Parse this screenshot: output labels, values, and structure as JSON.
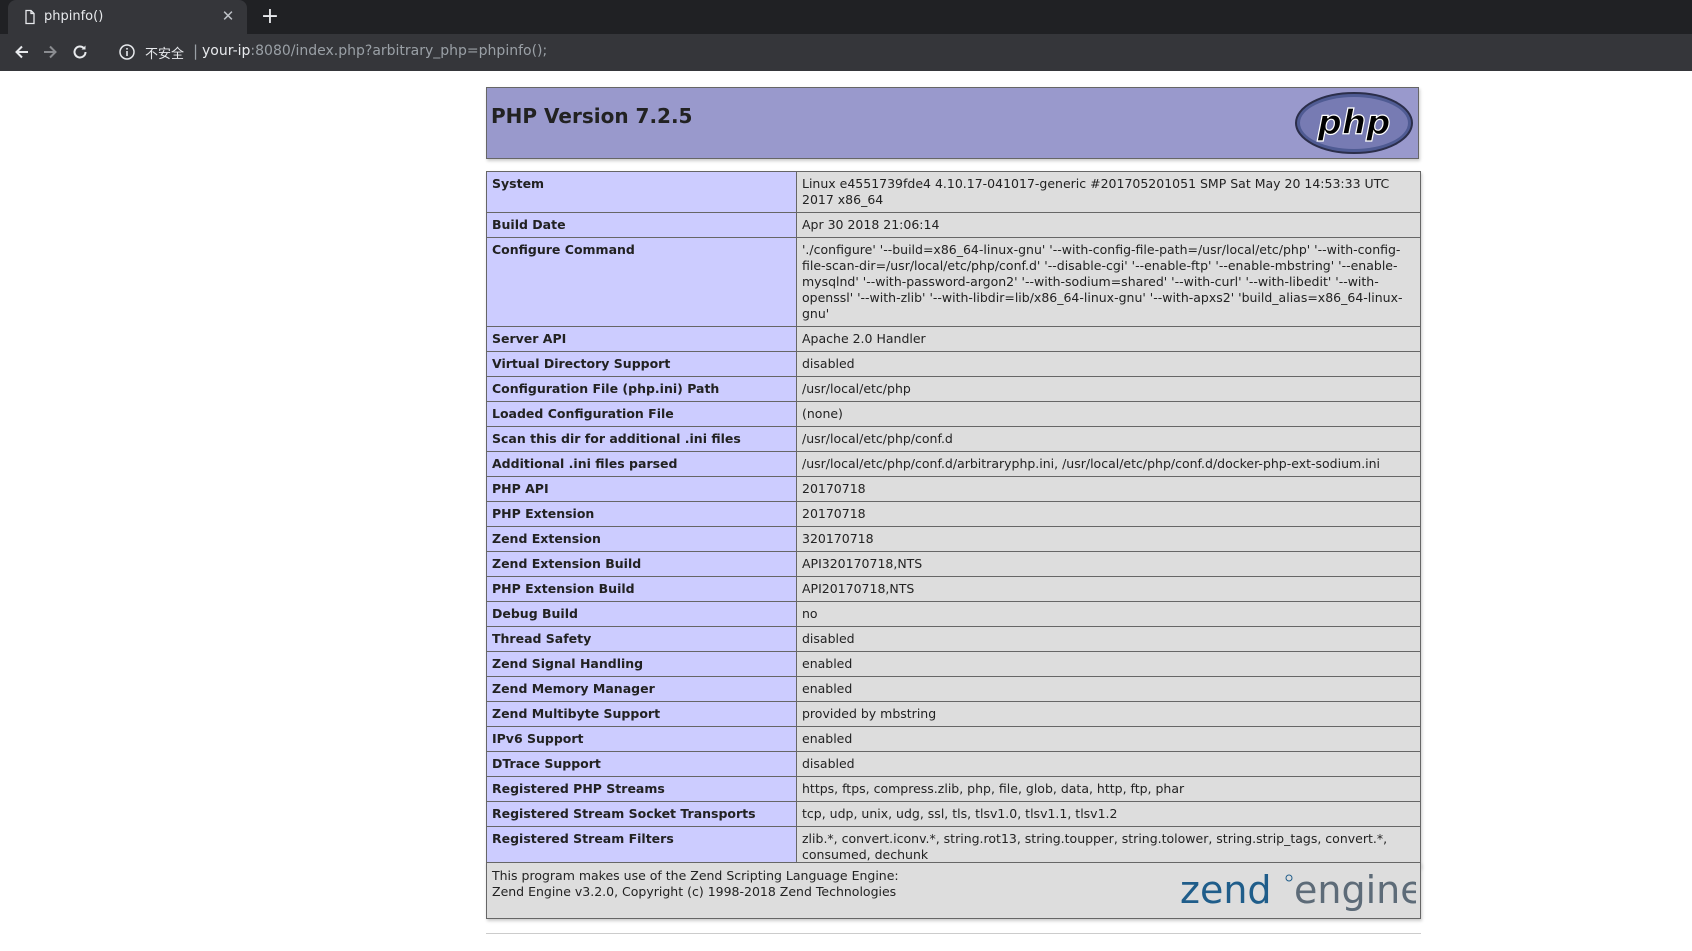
{
  "browser": {
    "tab_title": "phpinfo()",
    "insecure_label": "不安全",
    "url_host": "your-ip",
    "url_rest": ":8080/index.php?arbitrary_php=phpinfo();"
  },
  "header": {
    "title": "PHP Version 7.2.5",
    "logo_text": "php"
  },
  "rows": [
    {
      "k": "System",
      "v": "Linux e4551739fde4 4.10.17-041017-generic #201705201051 SMP Sat May 20 14:53:33 UTC 2017 x86_64"
    },
    {
      "k": "Build Date",
      "v": "Apr 30 2018 21:06:14"
    },
    {
      "k": "Configure Command",
      "v": "'./configure' '--build=x86_64-linux-gnu' '--with-config-file-path=/usr/local/etc/php' '--with-config-file-scan-dir=/usr/local/etc/php/conf.d' '--disable-cgi' '--enable-ftp' '--enable-mbstring' '--enable-mysqlnd' '--with-password-argon2' '--with-sodium=shared' '--with-curl' '--with-libedit' '--with-openssl' '--with-zlib' '--with-libdir=lib/x86_64-linux-gnu' '--with-apxs2' 'build_alias=x86_64-linux-gnu'"
    },
    {
      "k": "Server API",
      "v": "Apache 2.0 Handler"
    },
    {
      "k": "Virtual Directory Support",
      "v": "disabled"
    },
    {
      "k": "Configuration File (php.ini) Path",
      "v": "/usr/local/etc/php"
    },
    {
      "k": "Loaded Configuration File",
      "v": "(none)"
    },
    {
      "k": "Scan this dir for additional .ini files",
      "v": "/usr/local/etc/php/conf.d"
    },
    {
      "k": "Additional .ini files parsed",
      "v": "/usr/local/etc/php/conf.d/arbitraryphp.ini, /usr/local/etc/php/conf.d/docker-php-ext-sodium.ini"
    },
    {
      "k": "PHP API",
      "v": "20170718"
    },
    {
      "k": "PHP Extension",
      "v": "20170718"
    },
    {
      "k": "Zend Extension",
      "v": "320170718"
    },
    {
      "k": "Zend Extension Build",
      "v": "API320170718,NTS"
    },
    {
      "k": "PHP Extension Build",
      "v": "API20170718,NTS"
    },
    {
      "k": "Debug Build",
      "v": "no"
    },
    {
      "k": "Thread Safety",
      "v": "disabled"
    },
    {
      "k": "Zend Signal Handling",
      "v": "enabled"
    },
    {
      "k": "Zend Memory Manager",
      "v": "enabled"
    },
    {
      "k": "Zend Multibyte Support",
      "v": "provided by mbstring"
    },
    {
      "k": "IPv6 Support",
      "v": "enabled"
    },
    {
      "k": "DTrace Support",
      "v": "disabled"
    },
    {
      "k": "Registered PHP Streams",
      "v": "https, ftps, compress.zlib, php, file, glob, data, http, ftp, phar"
    },
    {
      "k": "Registered Stream Socket Transports",
      "v": "tcp, udp, unix, udg, ssl, tls, tlsv1.0, tlsv1.1, tlsv1.2"
    },
    {
      "k": "Registered Stream Filters",
      "v": "zlib.*, convert.iconv.*, string.rot13, string.toupper, string.tolower, string.strip_tags, convert.*, consumed, dechunk"
    }
  ],
  "footer": {
    "line1": "This program makes use of the Zend Scripting Language Engine:",
    "line2": "Zend Engine v3.2.0, Copyright (c) 1998-2018 Zend Technologies",
    "logo_zend": "zend",
    "logo_engine": "engine"
  },
  "colors": {
    "header_bg": "#9999cc",
    "key_bg": "#ccccff",
    "value_bg": "#dddddd"
  }
}
